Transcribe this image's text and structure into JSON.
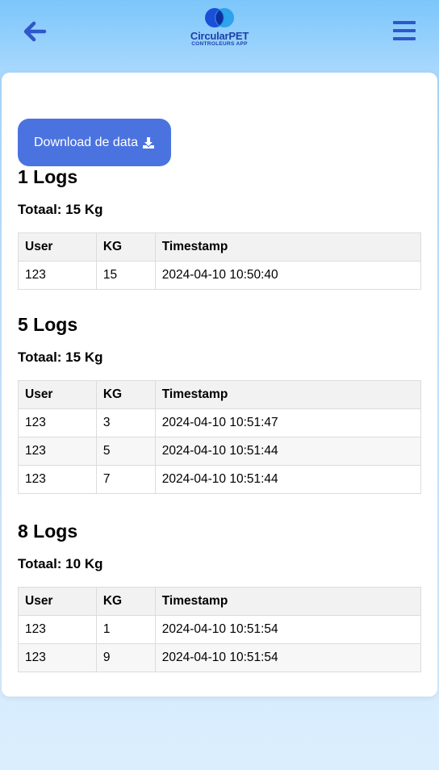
{
  "header": {
    "brand_name": "CircularPET",
    "brand_sub": "CONTROLEURS APP",
    "colors": {
      "brand": "#1f3fa8",
      "accent": "#4b73e0"
    },
    "back_icon": "arrow-left-icon",
    "menu_icon": "hamburger-menu-icon"
  },
  "actions": {
    "download_label": "Download de data",
    "download_icon": "download-icon"
  },
  "table_headers": {
    "user": "User",
    "kg": "KG",
    "timestamp": "Timestamp"
  },
  "sections": [
    {
      "title": "1 Logs",
      "total": "Totaal: 15 Kg",
      "rows": [
        {
          "user": "123",
          "kg": "15",
          "timestamp": "2024-04-10 10:50:40"
        }
      ]
    },
    {
      "title": "5 Logs",
      "total": "Totaal: 15 Kg",
      "rows": [
        {
          "user": "123",
          "kg": "3",
          "timestamp": "2024-04-10 10:51:47"
        },
        {
          "user": "123",
          "kg": "5",
          "timestamp": "2024-04-10 10:51:44"
        },
        {
          "user": "123",
          "kg": "7",
          "timestamp": "2024-04-10 10:51:44"
        }
      ]
    },
    {
      "title": "8 Logs",
      "total": "Totaal: 10 Kg",
      "rows": [
        {
          "user": "123",
          "kg": "1",
          "timestamp": "2024-04-10 10:51:54"
        },
        {
          "user": "123",
          "kg": "9",
          "timestamp": "2024-04-10 10:51:54"
        }
      ]
    }
  ]
}
